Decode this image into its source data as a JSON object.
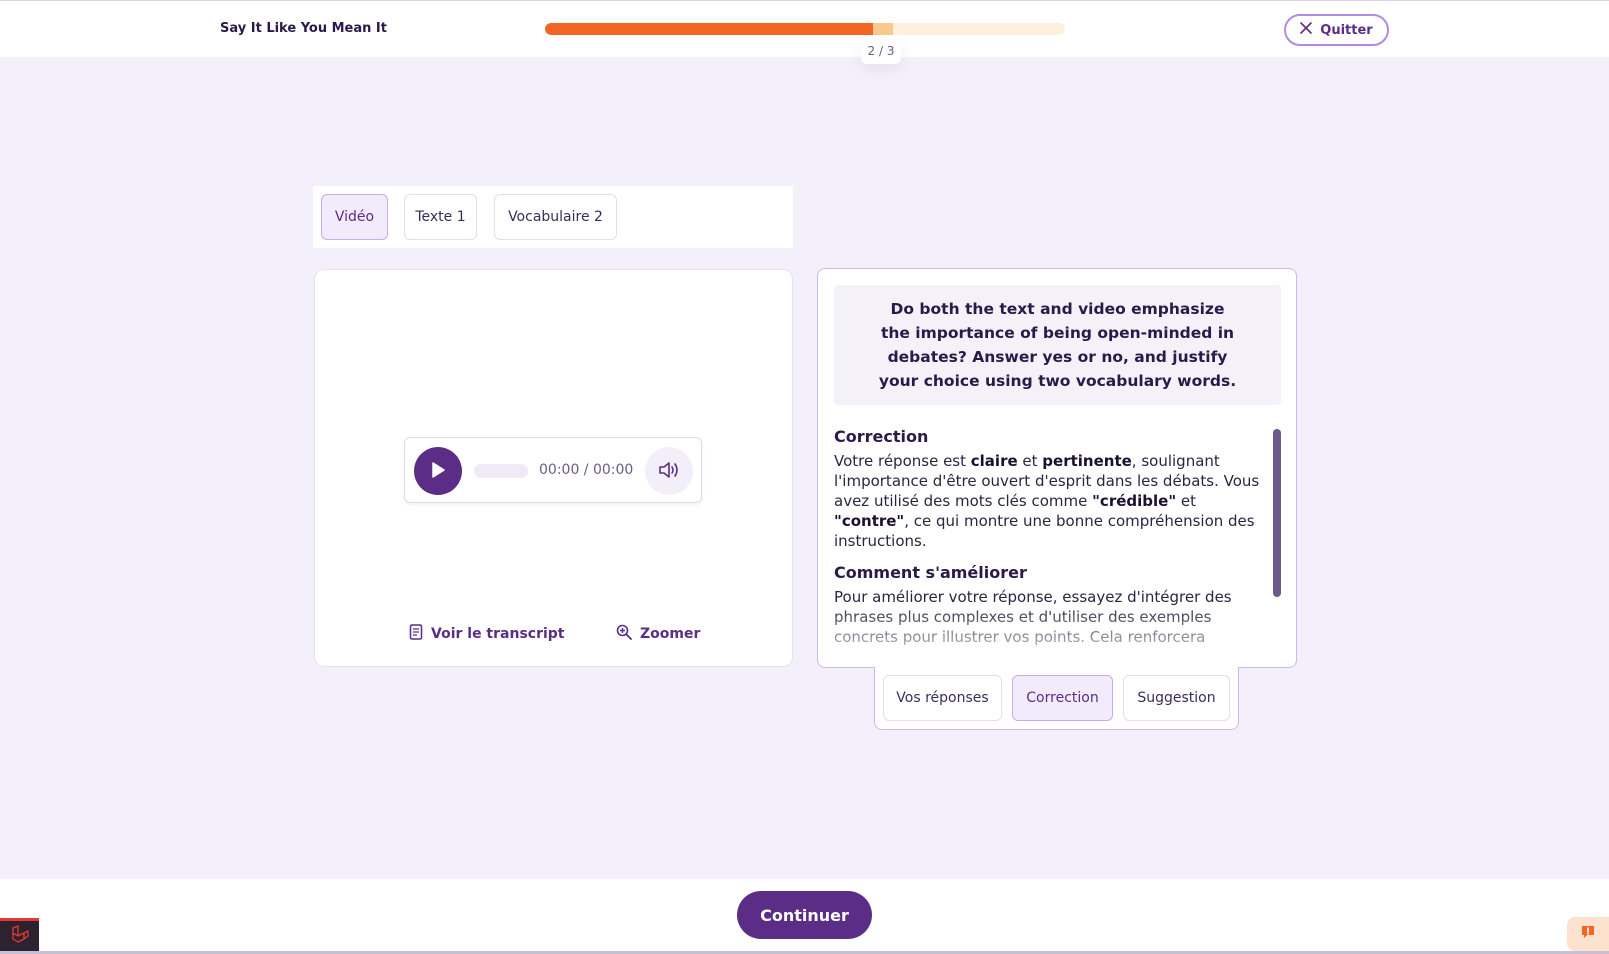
{
  "header": {
    "title": "Say It Like You Mean It",
    "progress": {
      "current": 2,
      "total": 3,
      "fraction": 0.63,
      "label": "2 / 3"
    },
    "quit_label": "Quitter"
  },
  "tabs": [
    {
      "label": "Vidéo",
      "active": true
    },
    {
      "label": "Texte 1",
      "active": false
    },
    {
      "label": "Vocabulaire 2",
      "active": false
    }
  ],
  "media": {
    "time": "00:00 / 00:00",
    "transcript_label": "Voir le transcript",
    "zoom_label": "Zoomer"
  },
  "question": {
    "text": "Do both the text and video emphasize the importance of being open-minded in debates? Answer yes or no, and justify your choice using two vocabulary words."
  },
  "feedback": {
    "correction_heading": "Correction",
    "correction_parts": {
      "p1": "Votre réponse est ",
      "b1": "claire",
      "p2": " et ",
      "b2": "pertinente",
      "p3": ", soulignant l'importance d'être ouvert d'esprit dans les débats. Vous avez utilisé des mots clés comme ",
      "b3": "\"crédible\"",
      "p4": " et ",
      "b4": "\"contre\"",
      "p5": ", ce qui montre une bonne compréhension des instructions."
    },
    "improve_heading": "Comment s'améliorer",
    "improve_text": "Pour améliorer votre réponse, essayez d'intégrer des phrases plus complexes et d'utiliser des exemples concrets pour illustrer vos points. Cela renforcera"
  },
  "answer_tabs": [
    {
      "label": "Vos réponses",
      "active": false
    },
    {
      "label": "Correction",
      "active": true
    },
    {
      "label": "Suggestion",
      "active": false
    }
  ],
  "footer": {
    "continue_label": "Continuer"
  },
  "colors": {
    "brand": "#5b2d86",
    "progress": "#f26522",
    "background": "#f3f0fb"
  }
}
